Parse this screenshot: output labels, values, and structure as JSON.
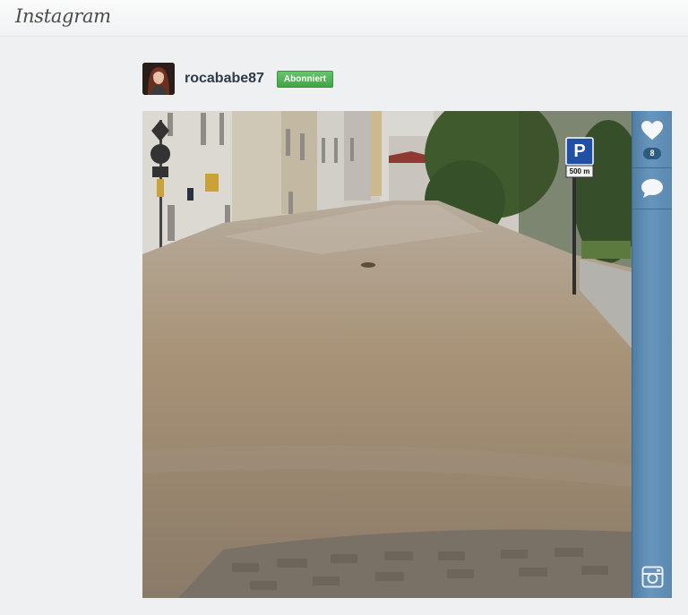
{
  "header": {
    "logo_text": "Instagram"
  },
  "post": {
    "username": "rocababe87",
    "follow_status": "Abonniert",
    "likes_count": "8",
    "photo_subject": "flooded street"
  },
  "sign": {
    "parking_letter": "P",
    "distance": "500 m"
  },
  "icons": {
    "like": "heart-icon",
    "comment": "comment-bubble-icon",
    "instagram": "instagram-camera-icon"
  },
  "colors": {
    "sidebar_blue": "#5a88b0",
    "follow_green": "#43a447",
    "background": "#eef0f2"
  }
}
